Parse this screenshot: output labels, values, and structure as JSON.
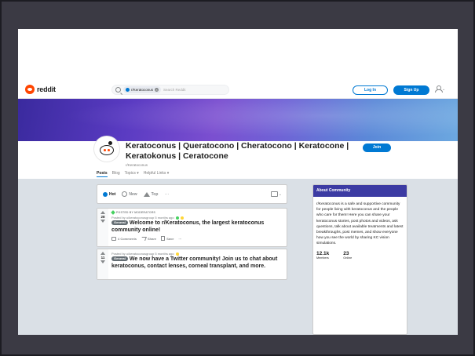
{
  "header": {
    "logo_text": "reddit",
    "search_chip": "r/Keratoconus",
    "search_placeholder": "Search Reddit",
    "login_label": "Log In",
    "signup_label": "Sign Up"
  },
  "community": {
    "title": "Keratoconus | Queratocono | Cheratocono | Keratocone | Keratokonus | Ceratocone",
    "subname": "r/Keratoconus",
    "join_label": "Join",
    "nav": [
      "Posts",
      "Blog",
      "Topics ▾",
      "Helpful Links ▾"
    ]
  },
  "sort": {
    "hot": "Hot",
    "new": "New",
    "top": "Top",
    "more": "···"
  },
  "posts": [
    {
      "pinned_label": "POSTED BY MODERATORS",
      "score": "28",
      "meta": "Posted by u/keratoconusgroup 5 months ago",
      "flair": "General",
      "title": "Welcome to r/Keratoconus, the largest keratoconus community online!",
      "comments": "4 Comments",
      "share": "Share",
      "save": "Save",
      "more": "···"
    },
    {
      "score": "11",
      "meta": "Posted by u/keratoconusgroup 5 months ago",
      "flair": "General",
      "title": "We now have a Twitter community! Join us to chat about keratoconus, contact lenses, corneal transplant, and more."
    }
  ],
  "about": {
    "heading": "About Community",
    "description": "r/Keratoconus is a safe and supportive community for people living with keratoconus and the people who care for them! Here you can share your keratoconus stories, post photos and videos, ask questions, talk about available treatments and latest breakthroughs, post memes, and show everyone how you see the world by sharing KC vision simulations.",
    "members_count": "12.1k",
    "members_label": "Members",
    "online_count": "23",
    "online_label": "Online"
  },
  "colors": {
    "brand": "#ff4500",
    "accent": "#0079d3",
    "about_header": "#3c3ba3"
  }
}
